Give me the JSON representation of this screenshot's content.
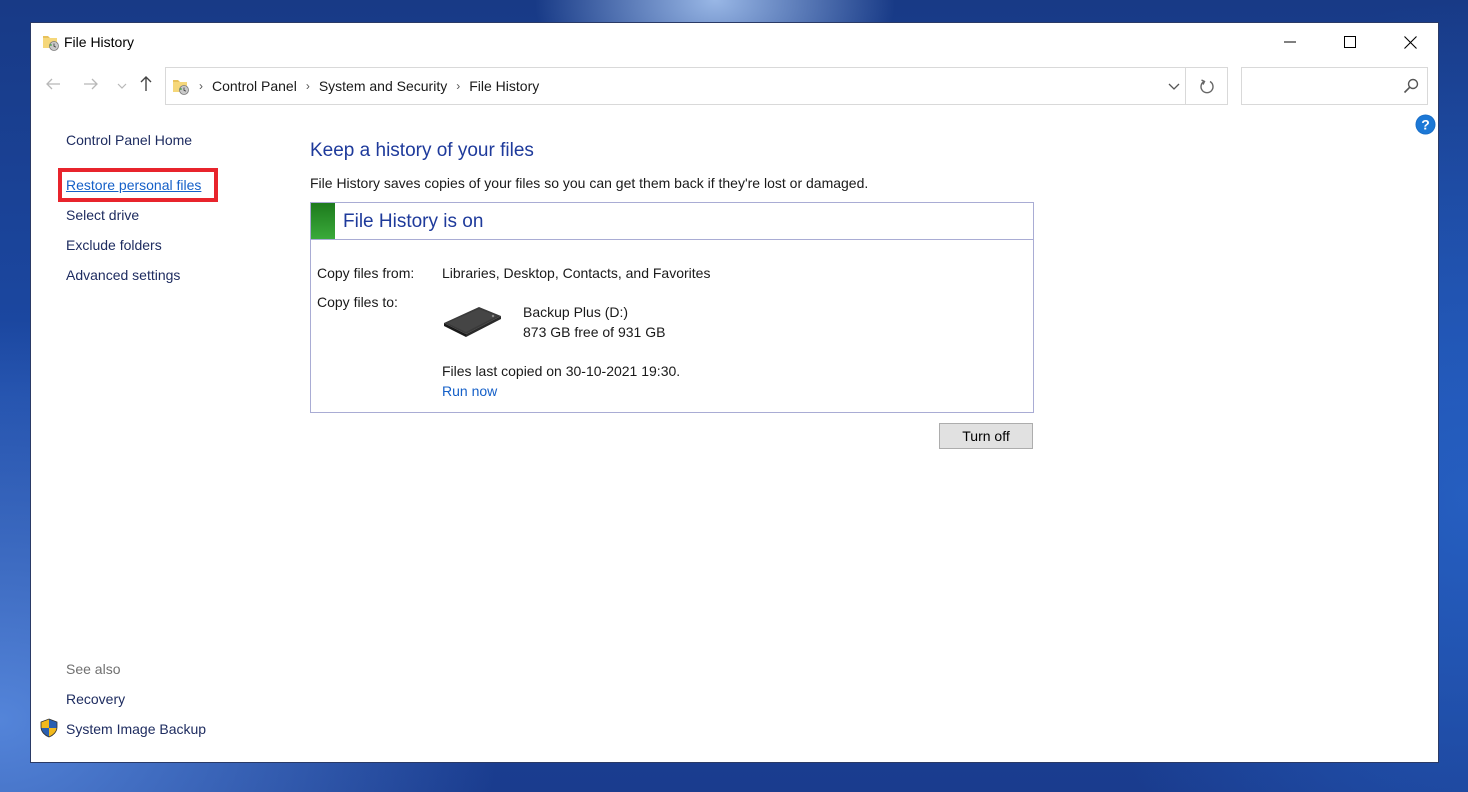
{
  "window": {
    "title": "File History",
    "controls": {
      "minimize": "minimize",
      "maximize": "maximize",
      "close": "close"
    }
  },
  "navigation": {
    "back_icon": "arrow-left",
    "forward_icon": "arrow-right",
    "recent_icon": "chevron-down",
    "up_icon": "arrow-up",
    "breadcrumb": [
      "Control Panel",
      "System and Security",
      "File History"
    ]
  },
  "search": {
    "placeholder": "",
    "value": ""
  },
  "sidebar": {
    "items": [
      {
        "label": "Control Panel Home"
      },
      {
        "label": "Restore personal files",
        "highlighted": true
      },
      {
        "label": "Select drive"
      },
      {
        "label": "Exclude folders"
      },
      {
        "label": "Advanced settings"
      }
    ],
    "see_also_label": "See also",
    "see_also": [
      {
        "label": "Recovery"
      },
      {
        "label": "System Image Backup",
        "icon": "uac-shield-icon"
      }
    ]
  },
  "main": {
    "title": "Keep a history of your files",
    "description": "File History saves copies of your files so you can get them back if they're lost or damaged.",
    "status": {
      "title": "File History is on",
      "state_color": "#2f9a2f",
      "copy_from_label": "Copy files from:",
      "copy_from_value": "Libraries, Desktop, Contacts, and Favorites",
      "copy_to_label": "Copy files to:",
      "drive_name": "Backup Plus (D:)",
      "drive_free": "873 GB free of 931 GB",
      "last_copied": "Files last copied on 30-10-2021 19:30.",
      "run_now": "Run now"
    },
    "turn_off_label": "Turn off"
  },
  "colors": {
    "heading": "#1e3a9b",
    "link": "#1560c8",
    "highlight_box": "#e8242c"
  }
}
